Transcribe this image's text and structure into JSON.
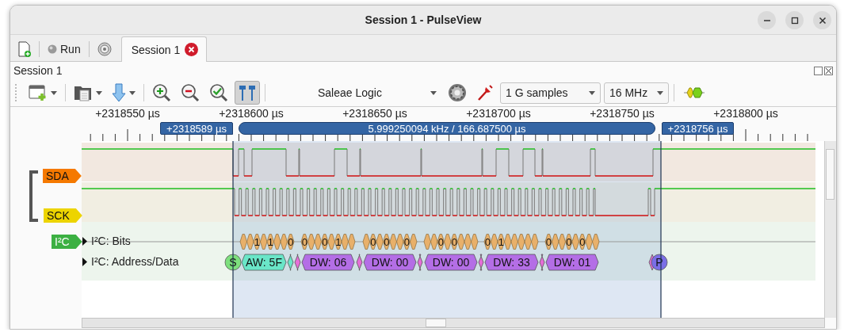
{
  "window": {
    "title": "Session 1 - PulseView"
  },
  "main_toolbar": {
    "run": {
      "label": "Run"
    }
  },
  "tabs": [
    {
      "label": "Session 1",
      "selected": true
    }
  ],
  "session": {
    "title": "Session 1"
  },
  "toolbar": {
    "cursor_toggle": {
      "on": true
    },
    "device": "Saleae Logic",
    "samples": "1 G samples",
    "samplerate": "16 MHz"
  },
  "ruler": {
    "ticks": [
      "+2318550 µs",
      "+2318600 µs",
      "+2318650 µs",
      "+2318700 µs",
      "+2318750 µs",
      "+2318800 µs"
    ],
    "markers": [
      {
        "kind": "cursor",
        "label": "+2318589 µs"
      },
      {
        "kind": "span",
        "label": "5.999250094 kHz / 166.687500 µs"
      },
      {
        "kind": "cursor",
        "label": "+2318756 µs"
      }
    ]
  },
  "channels": [
    {
      "name": "SDA",
      "color": "#f57900"
    },
    {
      "name": "SCK",
      "color": "#edd400"
    }
  ],
  "decoder": {
    "tag": "I²C",
    "color": "#3cb043",
    "rows": [
      {
        "label": "I²C: Bits",
        "expanded": false,
        "bit_groups": [
          [
            {
              "kind": "blank"
            },
            {
              "kind": "blank"
            },
            {
              "kind": "digit",
              "text": "1"
            },
            {
              "kind": "blank"
            },
            {
              "kind": "digit",
              "text": "1"
            },
            {
              "kind": "blank"
            },
            {
              "kind": "blank"
            },
            {
              "kind": "digit",
              "text": "0"
            }
          ],
          [
            {
              "kind": "digit",
              "text": "0"
            },
            {
              "kind": "blank"
            },
            {
              "kind": "blank"
            },
            {
              "kind": "digit",
              "text": "0"
            },
            {
              "kind": "blank"
            },
            {
              "kind": "digit",
              "text": "1"
            },
            {
              "kind": "blank"
            },
            {
              "kind": "blank"
            }
          ],
          [
            {
              "kind": "blank"
            },
            {
              "kind": "digit",
              "text": "0"
            },
            {
              "kind": "blank"
            },
            {
              "kind": "digit",
              "text": "0"
            },
            {
              "kind": "blank"
            },
            {
              "kind": "blank"
            },
            {
              "kind": "digit",
              "text": "0"
            },
            {
              "kind": "blank"
            }
          ],
          [
            {
              "kind": "blank"
            },
            {
              "kind": "blank"
            },
            {
              "kind": "digit",
              "text": "0"
            },
            {
              "kind": "blank"
            },
            {
              "kind": "digit",
              "text": "0"
            },
            {
              "kind": "blank"
            },
            {
              "kind": "blank"
            },
            {
              "kind": "blank"
            }
          ],
          [
            {
              "kind": "digit",
              "text": "0"
            },
            {
              "kind": "blank"
            },
            {
              "kind": "digit",
              "text": "1"
            },
            {
              "kind": "blank"
            },
            {
              "kind": "blank"
            },
            {
              "kind": "blank"
            },
            {
              "kind": "blank"
            },
            {
              "kind": "blank"
            }
          ],
          [
            {
              "kind": "digit",
              "text": "0"
            },
            {
              "kind": "blank"
            },
            {
              "kind": "blank"
            },
            {
              "kind": "digit",
              "text": "0"
            },
            {
              "kind": "blank"
            },
            {
              "kind": "digit",
              "text": "0"
            },
            {
              "kind": "blank"
            },
            {
              "kind": "blank"
            }
          ]
        ]
      },
      {
        "label": "I²C: Address/Data",
        "expanded": false,
        "annotations": [
          {
            "kind": "start",
            "text": "S"
          },
          {
            "kind": "address",
            "text": "AW: 5F"
          },
          {
            "kind": "rw"
          },
          {
            "kind": "ack"
          },
          {
            "kind": "data",
            "text": "DW: 06"
          },
          {
            "kind": "ack"
          },
          {
            "kind": "data",
            "text": "DW: 00"
          },
          {
            "kind": "ack"
          },
          {
            "kind": "data",
            "text": "DW: 00"
          },
          {
            "kind": "ack"
          },
          {
            "kind": "data",
            "text": "DW: 33"
          },
          {
            "kind": "ack"
          },
          {
            "kind": "data",
            "text": "DW: 01"
          },
          {
            "kind": "ack"
          },
          {
            "kind": "stop",
            "text": "P"
          }
        ]
      }
    ]
  }
}
